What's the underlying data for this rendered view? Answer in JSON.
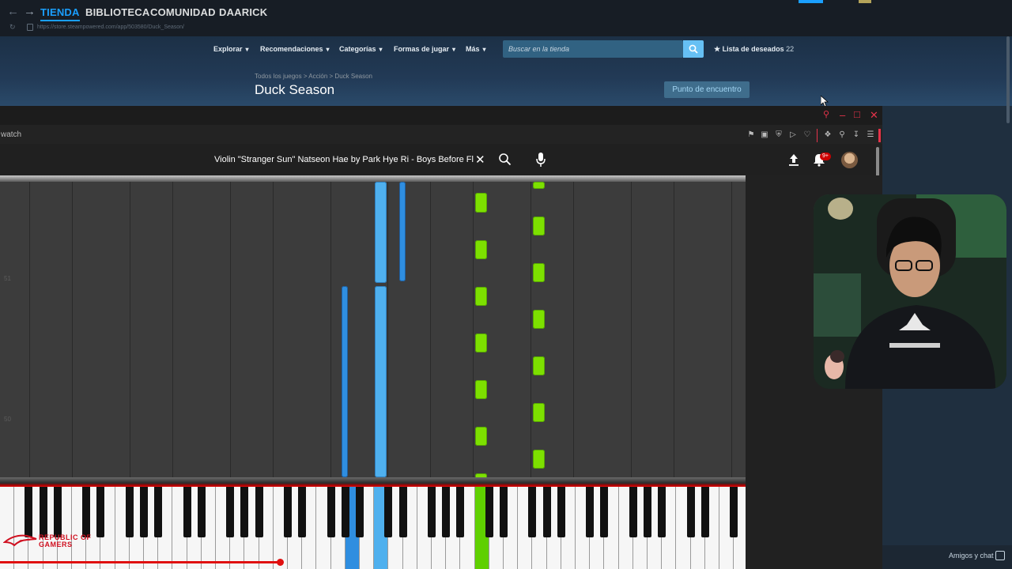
{
  "steam": {
    "menu": [
      "TIENDA",
      "BIBLIOTECA",
      "COMUNIDAD",
      "DAARICK"
    ],
    "url": "https://store.steampowered.com/app/503580/Duck_Season/",
    "store_nav": [
      "Explorar",
      "Recomendaciones",
      "Categorías",
      "Formas de jugar",
      "Más"
    ],
    "search_placeholder": "Buscar en la tienda",
    "wishlist_label": "Lista de deseados",
    "wishlist_count": "22",
    "breadcrumb": [
      "Todos los juegos",
      "Acción",
      "Duck Season"
    ],
    "game_title": "Duck Season",
    "community_button": "Punto de encuentro",
    "friends_chat": "Amigos y chat",
    "accent_color": "#1a9fff"
  },
  "browser": {
    "tab_label": "watch",
    "search_query": "Violin \"Stranger Sun\" Natseon Hae by Park Hye Ri - Boys Before Flowe",
    "notification_count": "9+"
  },
  "video": {
    "side_numbers": [
      "51",
      "50"
    ],
    "note_colors": {
      "left_hand": "#4fb0ee",
      "right_hand": "#7de000"
    },
    "watermark": "REPUBLIC OF GAMERS"
  }
}
